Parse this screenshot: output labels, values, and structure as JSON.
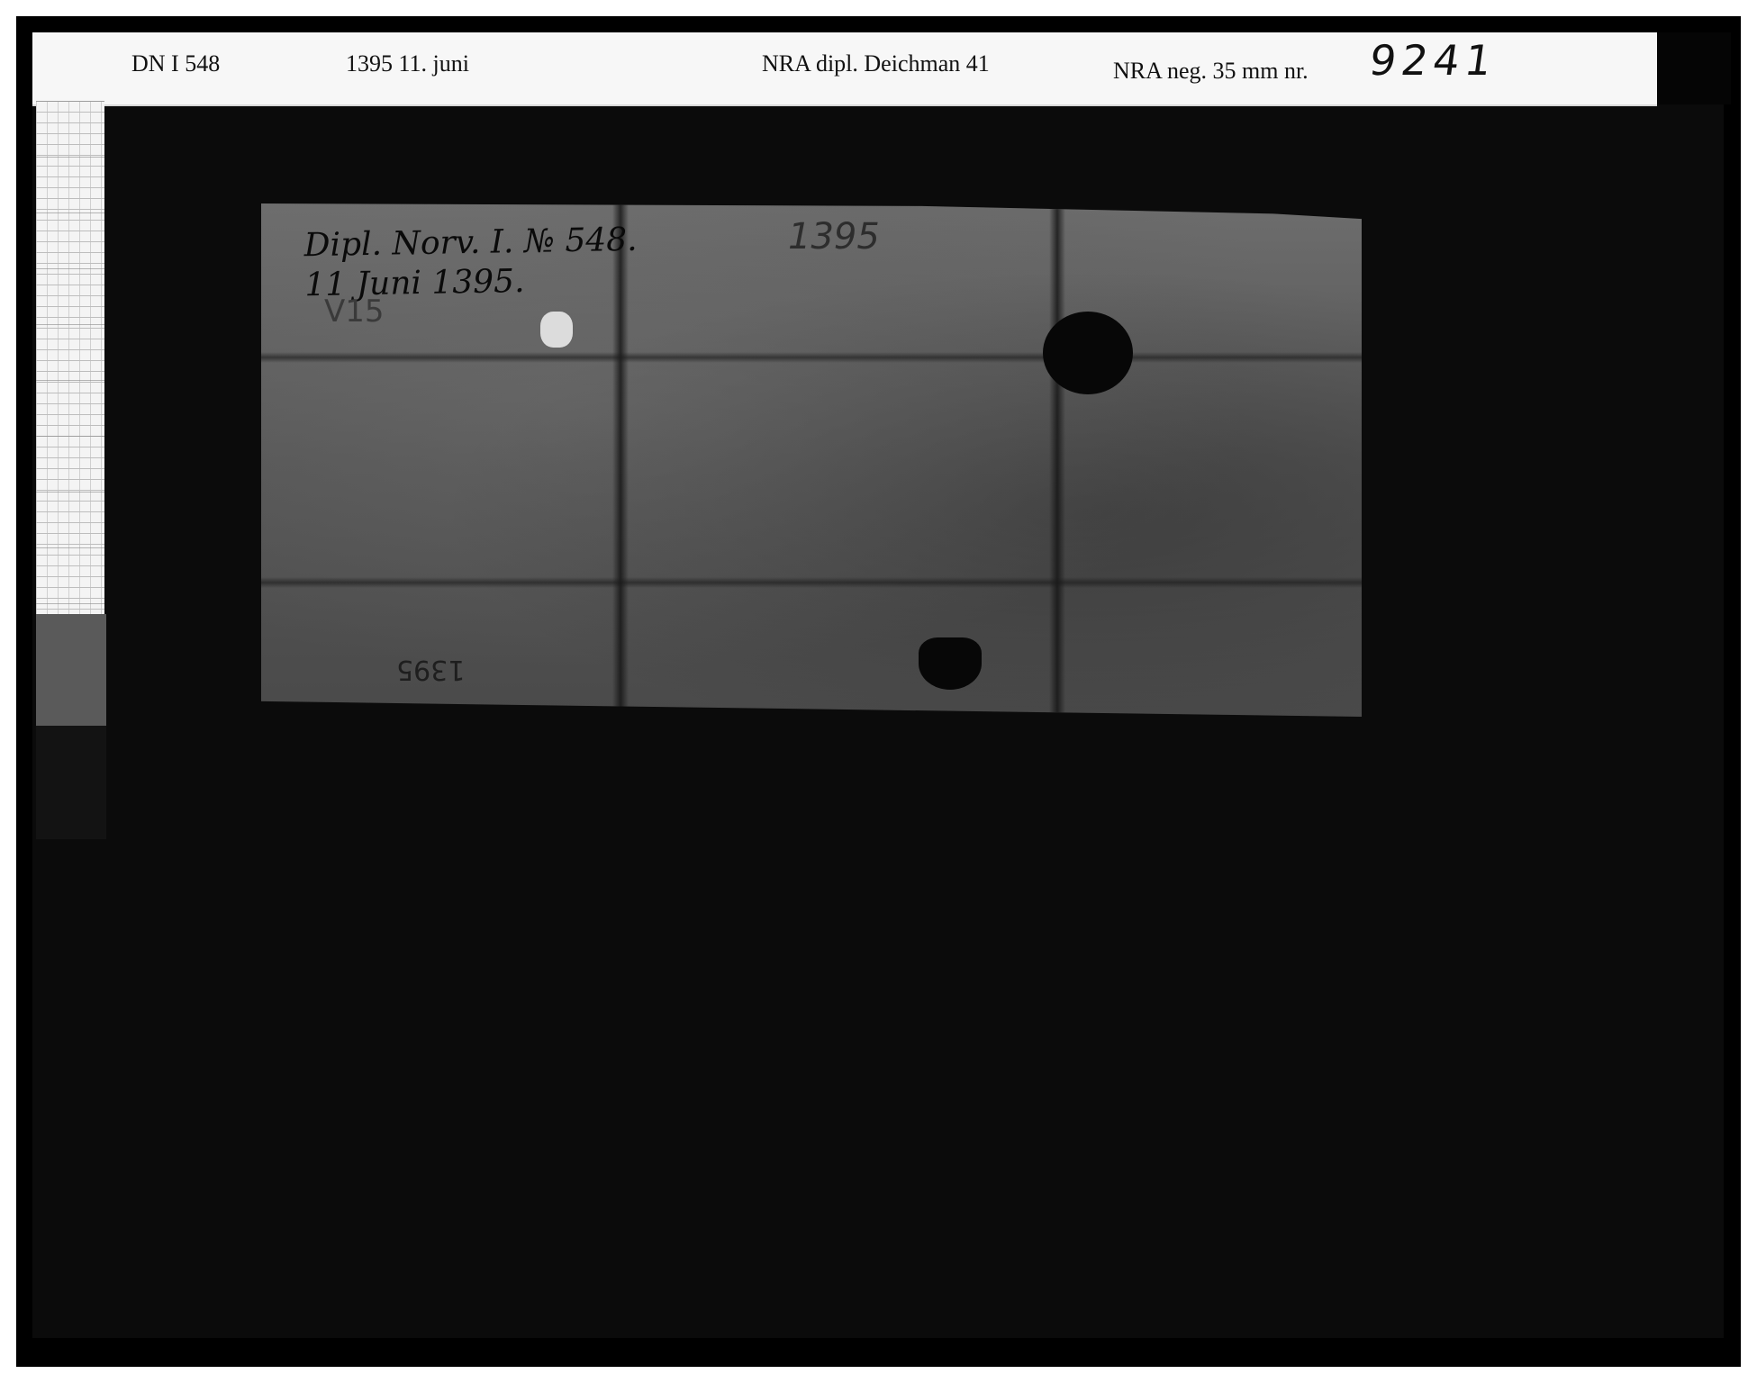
{
  "label": {
    "signum": "DN I 548",
    "date": "1395  11. juni",
    "archive_ref": "NRA dipl. Deichman 41",
    "negative_label": "NRA neg. 35 mm nr.",
    "negative_number": "9241"
  },
  "document": {
    "note_line_1": "Dipl. Norv. I. № 548.",
    "note_line_2": "11 Juni 1395.",
    "year_mark": "1395",
    "v_mark": "V15",
    "bottom_mark": "1395"
  },
  "colors": {
    "background_black": "#000000",
    "label_strip": "#f7f7f7",
    "parchment": "#5a5a5a"
  }
}
